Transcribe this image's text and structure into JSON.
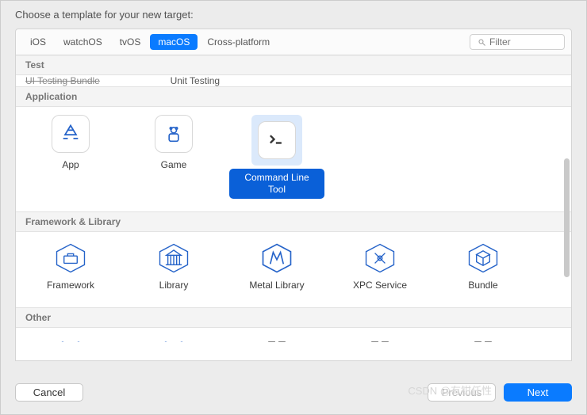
{
  "header": {
    "title": "Choose a template for your new target:"
  },
  "platforms": {
    "tabs": [
      "iOS",
      "watchOS",
      "tvOS",
      "macOS",
      "Cross-platform"
    ],
    "selected": "macOS"
  },
  "filter": {
    "placeholder": "Filter",
    "value": ""
  },
  "sections": {
    "test": {
      "title": "Test",
      "partial_items": [
        "UI Testing Bundle",
        "Unit Testing Bundle"
      ]
    },
    "application": {
      "title": "Application",
      "items": [
        {
          "label": "App",
          "icon": "app-store-icon"
        },
        {
          "label": "Game",
          "icon": "game-icon"
        },
        {
          "label": "Command Line Tool",
          "icon": "terminal-icon",
          "selected": true
        }
      ]
    },
    "framework": {
      "title": "Framework & Library",
      "items": [
        {
          "label": "Framework",
          "icon": "toolbox-icon"
        },
        {
          "label": "Library",
          "icon": "library-icon"
        },
        {
          "label": "Metal Library",
          "icon": "metal-icon"
        },
        {
          "label": "XPC Service",
          "icon": "xpc-icon"
        },
        {
          "label": "Bundle",
          "icon": "bundle-icon"
        }
      ]
    },
    "other": {
      "title": "Other"
    }
  },
  "buttons": {
    "cancel": "Cancel",
    "previous": "Previous",
    "next": "Next"
  },
  "watermark": "CSDN @有钳任性"
}
